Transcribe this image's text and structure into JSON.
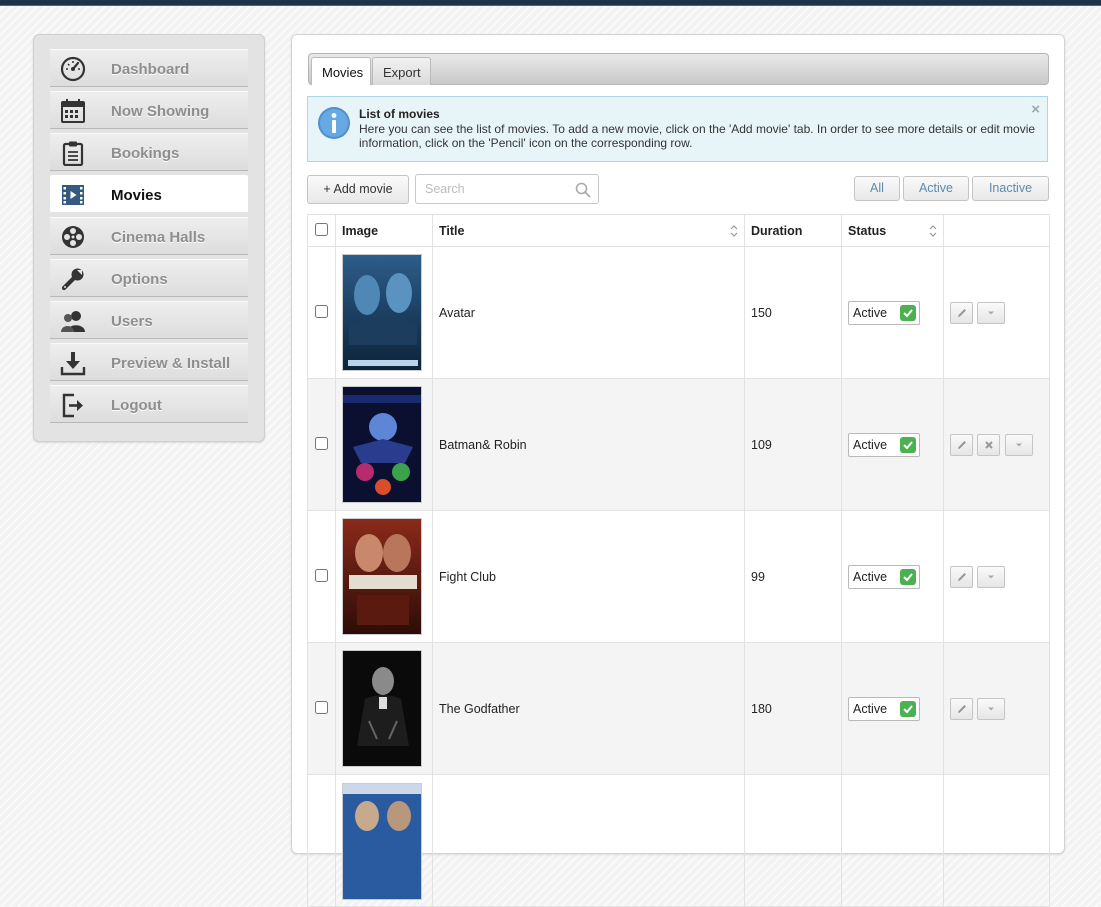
{
  "sidebar": {
    "items": [
      {
        "label": "Dashboard",
        "icon": "gauge-icon",
        "active": false
      },
      {
        "label": "Now Showing",
        "icon": "calendar-icon",
        "active": false
      },
      {
        "label": "Bookings",
        "icon": "clipboard-icon",
        "active": false
      },
      {
        "label": "Movies",
        "icon": "film-icon",
        "active": true
      },
      {
        "label": "Cinema Halls",
        "icon": "film-reel-icon",
        "active": false
      },
      {
        "label": "Options",
        "icon": "wrench-icon",
        "active": false
      },
      {
        "label": "Users",
        "icon": "users-icon",
        "active": false
      },
      {
        "label": "Preview & Install",
        "icon": "download-icon",
        "active": false
      },
      {
        "label": "Logout",
        "icon": "logout-icon",
        "active": false
      }
    ]
  },
  "tabs": [
    {
      "label": "Movies",
      "active": true
    },
    {
      "label": "Export",
      "active": false
    }
  ],
  "info": {
    "title": "List of movies",
    "text": "Here you can see the list of movies. To add a new movie, click on the 'Add movie' tab. In order to see more details or edit movie information, click on the 'Pencil' icon on the corresponding row.",
    "close": "×"
  },
  "toolbar": {
    "add_label": "+ Add movie",
    "search_placeholder": "Search",
    "filters": [
      "All",
      "Active",
      "Inactive"
    ]
  },
  "table": {
    "columns": [
      "Image",
      "Title",
      "Duration",
      "Status"
    ],
    "rows": [
      {
        "title": "Avatar",
        "duration": "150",
        "status": "Active",
        "deletable": false
      },
      {
        "title": "Batman& Robin",
        "duration": "109",
        "status": "Active",
        "deletable": true
      },
      {
        "title": "Fight Club",
        "duration": "99",
        "status": "Active",
        "deletable": false
      },
      {
        "title": "The Godfather",
        "duration": "180",
        "status": "Active",
        "deletable": false
      },
      {
        "title": "",
        "duration": "",
        "status": "",
        "deletable": true
      }
    ]
  },
  "colors": {
    "accent": "#355a80",
    "status_ok": "#4cb150",
    "info_bg": "#e8f5f8",
    "filter_text": "#5a8bb0"
  }
}
